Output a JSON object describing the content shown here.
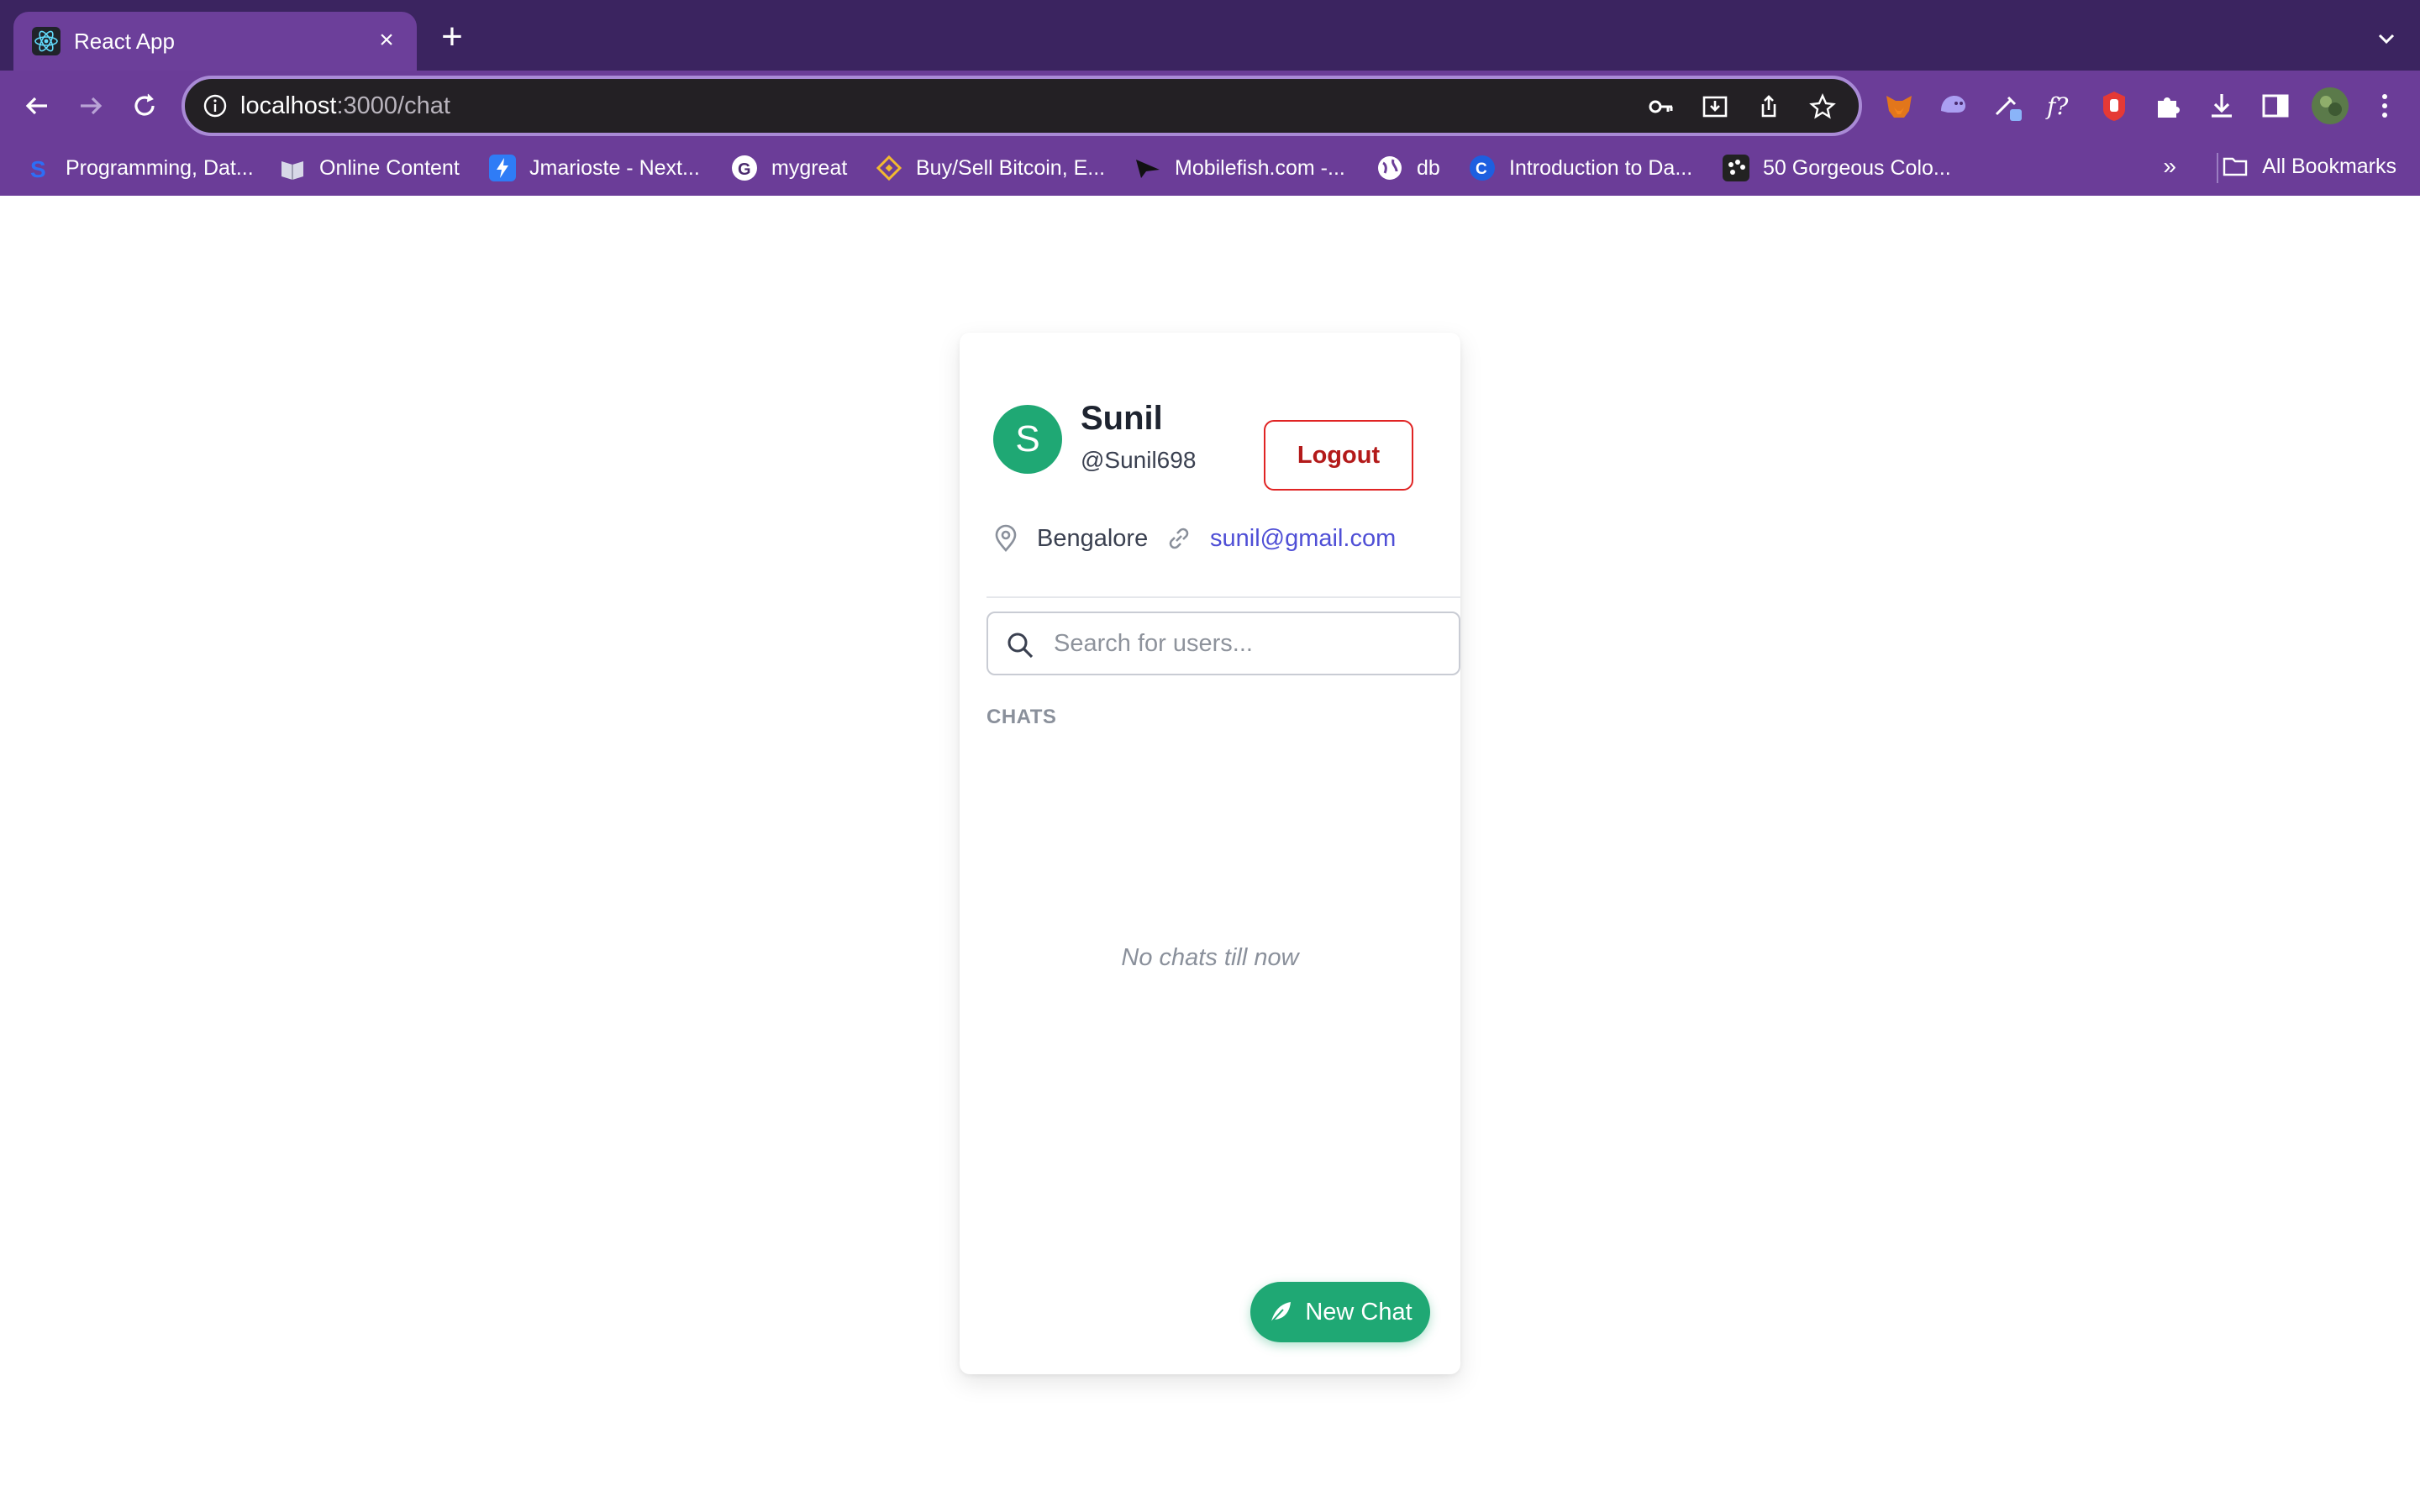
{
  "browser": {
    "tab": {
      "title": "React App",
      "favicon": "react-icon"
    },
    "url": {
      "host": "localhost",
      "path": ":3000/chat"
    },
    "bookmarks": [
      {
        "label": "Programming, Dat...",
        "icon": "s-logo-icon"
      },
      {
        "label": "Online Content",
        "icon": "book-icon"
      },
      {
        "label": "Jmarioste - Next...",
        "icon": "bolt-icon"
      },
      {
        "label": "mygreat",
        "icon": "google-icon"
      },
      {
        "label": "Buy/Sell Bitcoin, E...",
        "icon": "binance-icon"
      },
      {
        "label": "Mobilefish.com -...",
        "icon": "fish-icon"
      },
      {
        "label": "db",
        "icon": "globe-icon"
      },
      {
        "label": "Introduction to Da...",
        "icon": "c-logo-icon"
      },
      {
        "label": "50 Gorgeous Colo...",
        "icon": "palette-icon"
      }
    ],
    "more_bookmarks": "»",
    "all_bookmarks": "All Bookmarks"
  },
  "profile": {
    "avatar_letter": "S",
    "name": "Sunil",
    "handle": "@Sunil698",
    "location": "Bengalore",
    "email": "sunil@gmail.com",
    "logout_label": "Logout"
  },
  "search": {
    "placeholder": "Search for users..."
  },
  "chats": {
    "heading": "CHATS",
    "empty_message": "No chats till now"
  },
  "new_chat_label": "New Chat",
  "colors": {
    "accent_green": "#1fa874",
    "logout_red": "#e02424",
    "link_blue": "#4f4fd6",
    "chrome_purple": "#6b3d98"
  }
}
